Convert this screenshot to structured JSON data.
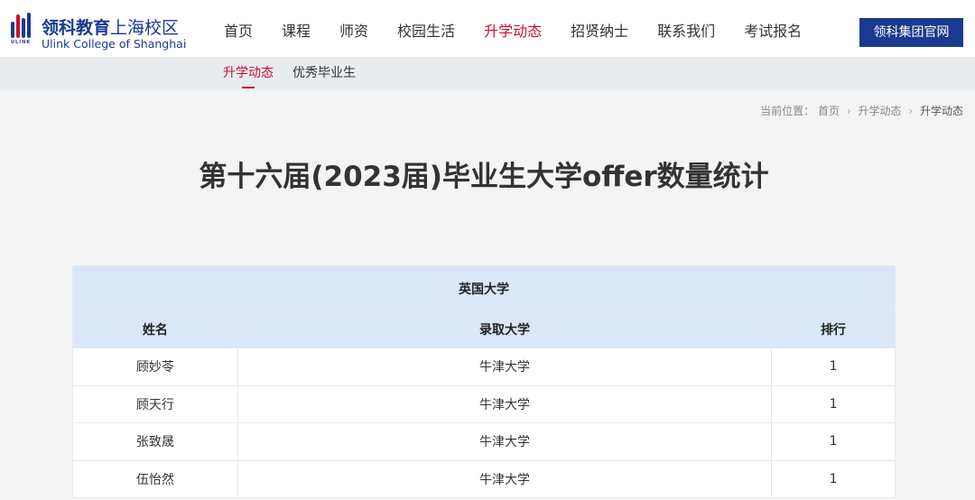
{
  "header": {
    "logo": {
      "cn_bold": "领科教育",
      "cn_light": "上海校区",
      "en": "Ulink College of Shanghai",
      "mark_text": "ULINK"
    },
    "nav": [
      {
        "label": "首页",
        "active": false
      },
      {
        "label": "课程",
        "active": false
      },
      {
        "label": "师资",
        "active": false
      },
      {
        "label": "校园生活",
        "active": false
      },
      {
        "label": "升学动态",
        "active": true
      },
      {
        "label": "招贤纳士",
        "active": false
      },
      {
        "label": "联系我们",
        "active": false
      },
      {
        "label": "考试报名",
        "active": false
      }
    ],
    "official_button": "领科集团官网"
  },
  "subnav": [
    {
      "label": "升学动态",
      "active": true
    },
    {
      "label": "优秀毕业生",
      "active": false
    }
  ],
  "breadcrumb": {
    "prefix": "当前位置：",
    "items": [
      "首页",
      "升学动态",
      "升学动态"
    ]
  },
  "page_title": "第十六届(2023届)毕业生大学offer数量统计",
  "table": {
    "caption": "英国大学",
    "columns": [
      "姓名",
      "录取大学",
      "排行"
    ],
    "rows": [
      [
        "顾妙苓",
        "牛津大学",
        "1"
      ],
      [
        "顾天行",
        "牛津大学",
        "1"
      ],
      [
        "张致晟",
        "牛津大学",
        "1"
      ],
      [
        "伍怡然",
        "牛津大学",
        "1"
      ]
    ]
  },
  "colors": {
    "brand_blue": "#1a3a8f",
    "accent_red": "#c8102e",
    "table_header_bg": "#dbe7f7"
  }
}
